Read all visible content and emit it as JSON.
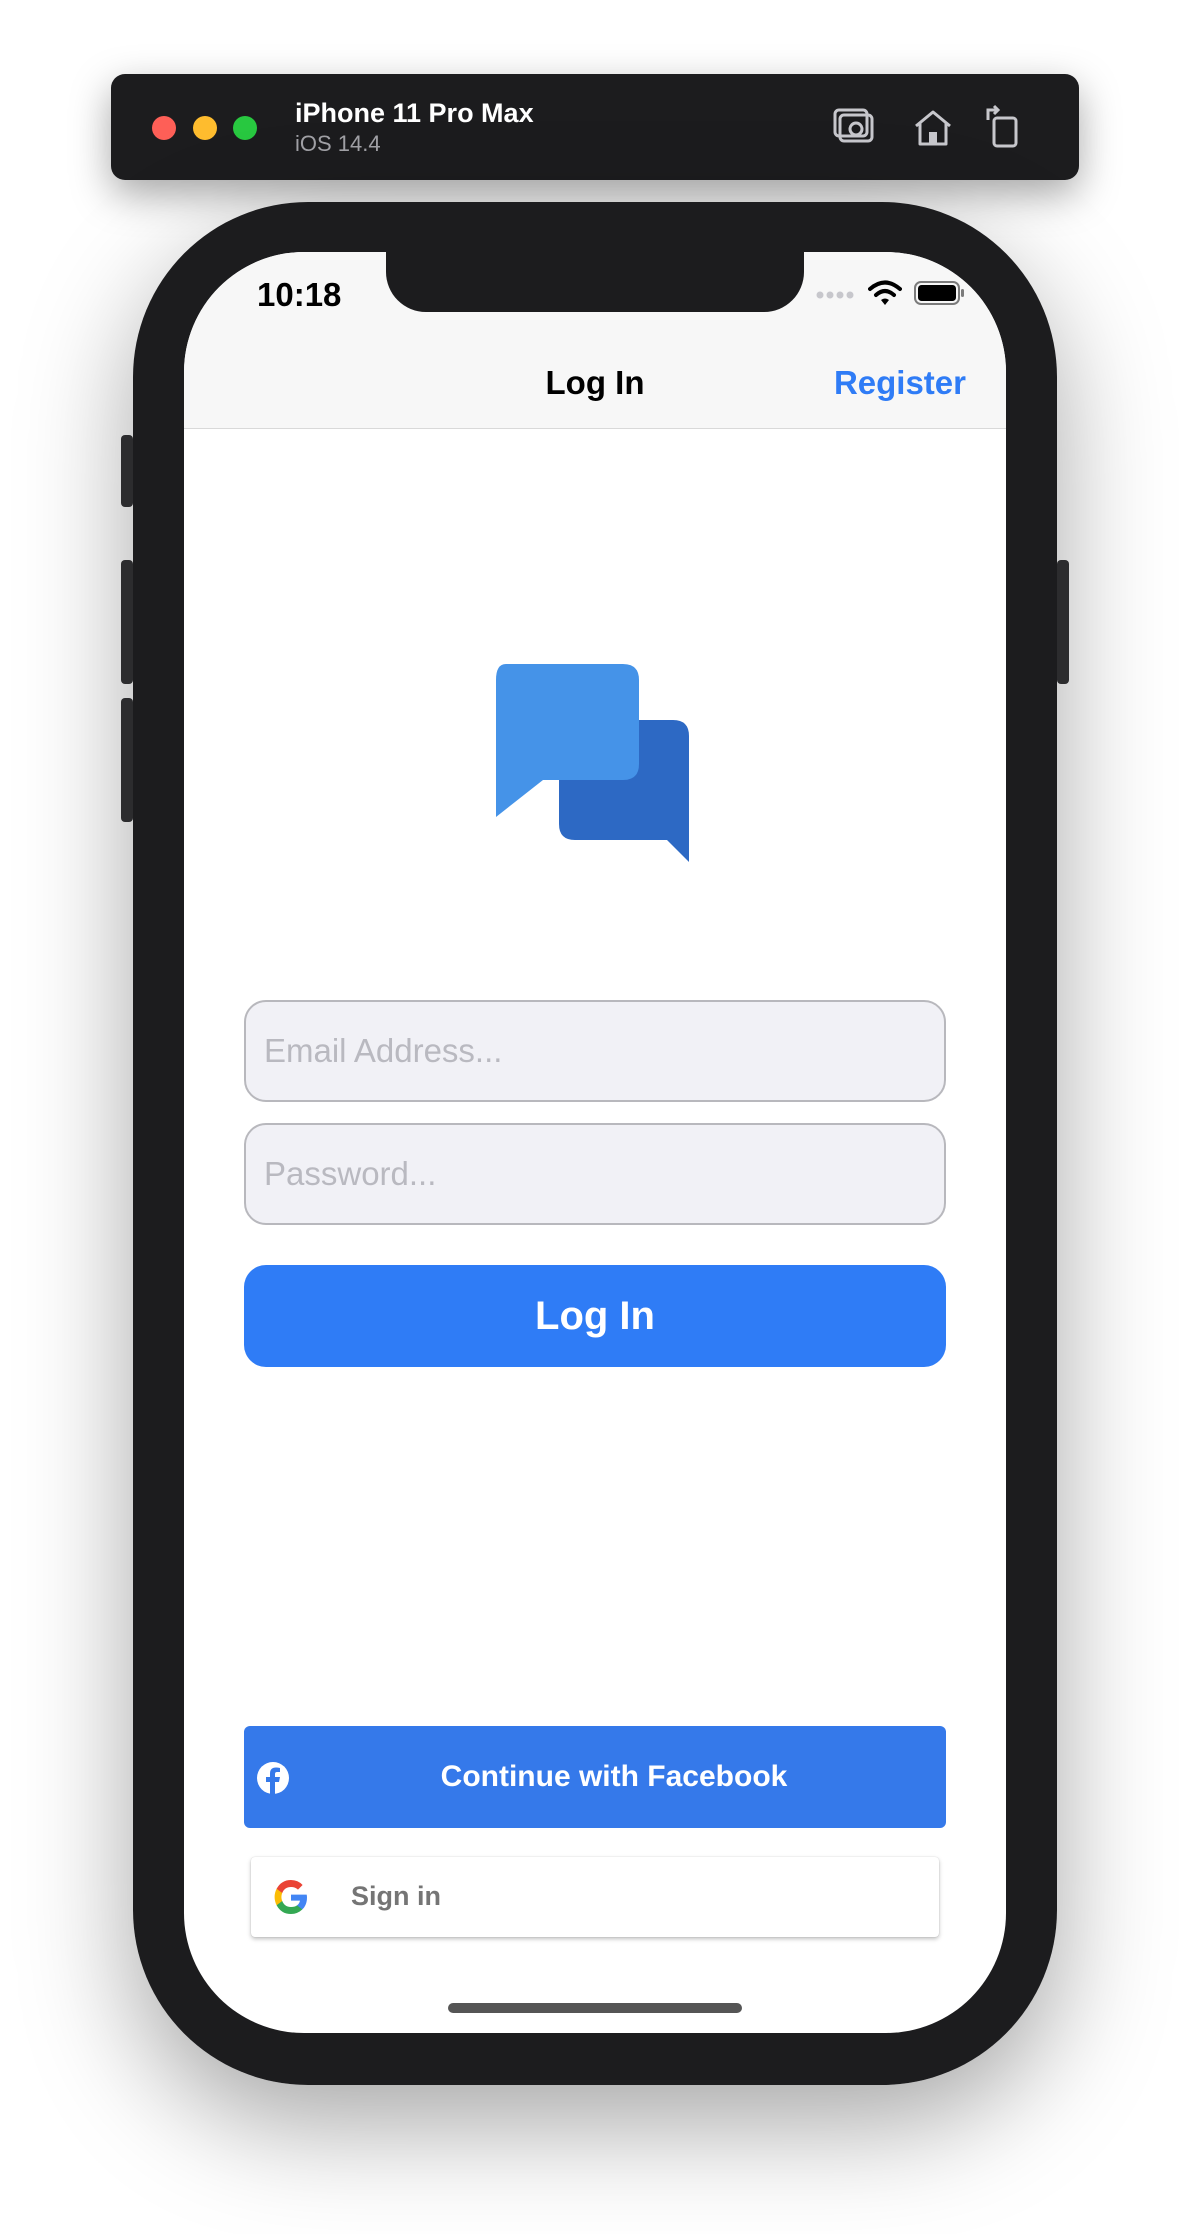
{
  "simulator": {
    "device_name": "iPhone 11 Pro Max",
    "os_version": "iOS 14.4",
    "toolbar_icons": [
      "screenshot-icon",
      "home-icon",
      "rotate-icon"
    ]
  },
  "status_bar": {
    "time": "10:18",
    "icons": [
      "signal-icon",
      "wifi-icon",
      "battery-icon"
    ]
  },
  "navbar": {
    "title": "Log In",
    "register_label": "Register"
  },
  "logo": {
    "icon": "chat-bubbles-icon",
    "colors": [
      "#4593e8",
      "#2d69c4"
    ]
  },
  "form": {
    "email_placeholder": "Email Address...",
    "password_placeholder": "Password...",
    "login_label": "Log In"
  },
  "social": {
    "facebook_label": "Continue with Facebook",
    "google_label": "Sign in"
  },
  "colors": {
    "accent": "#2f7cf6",
    "facebook": "#3579ea",
    "field_bg": "#f1f1f6"
  }
}
